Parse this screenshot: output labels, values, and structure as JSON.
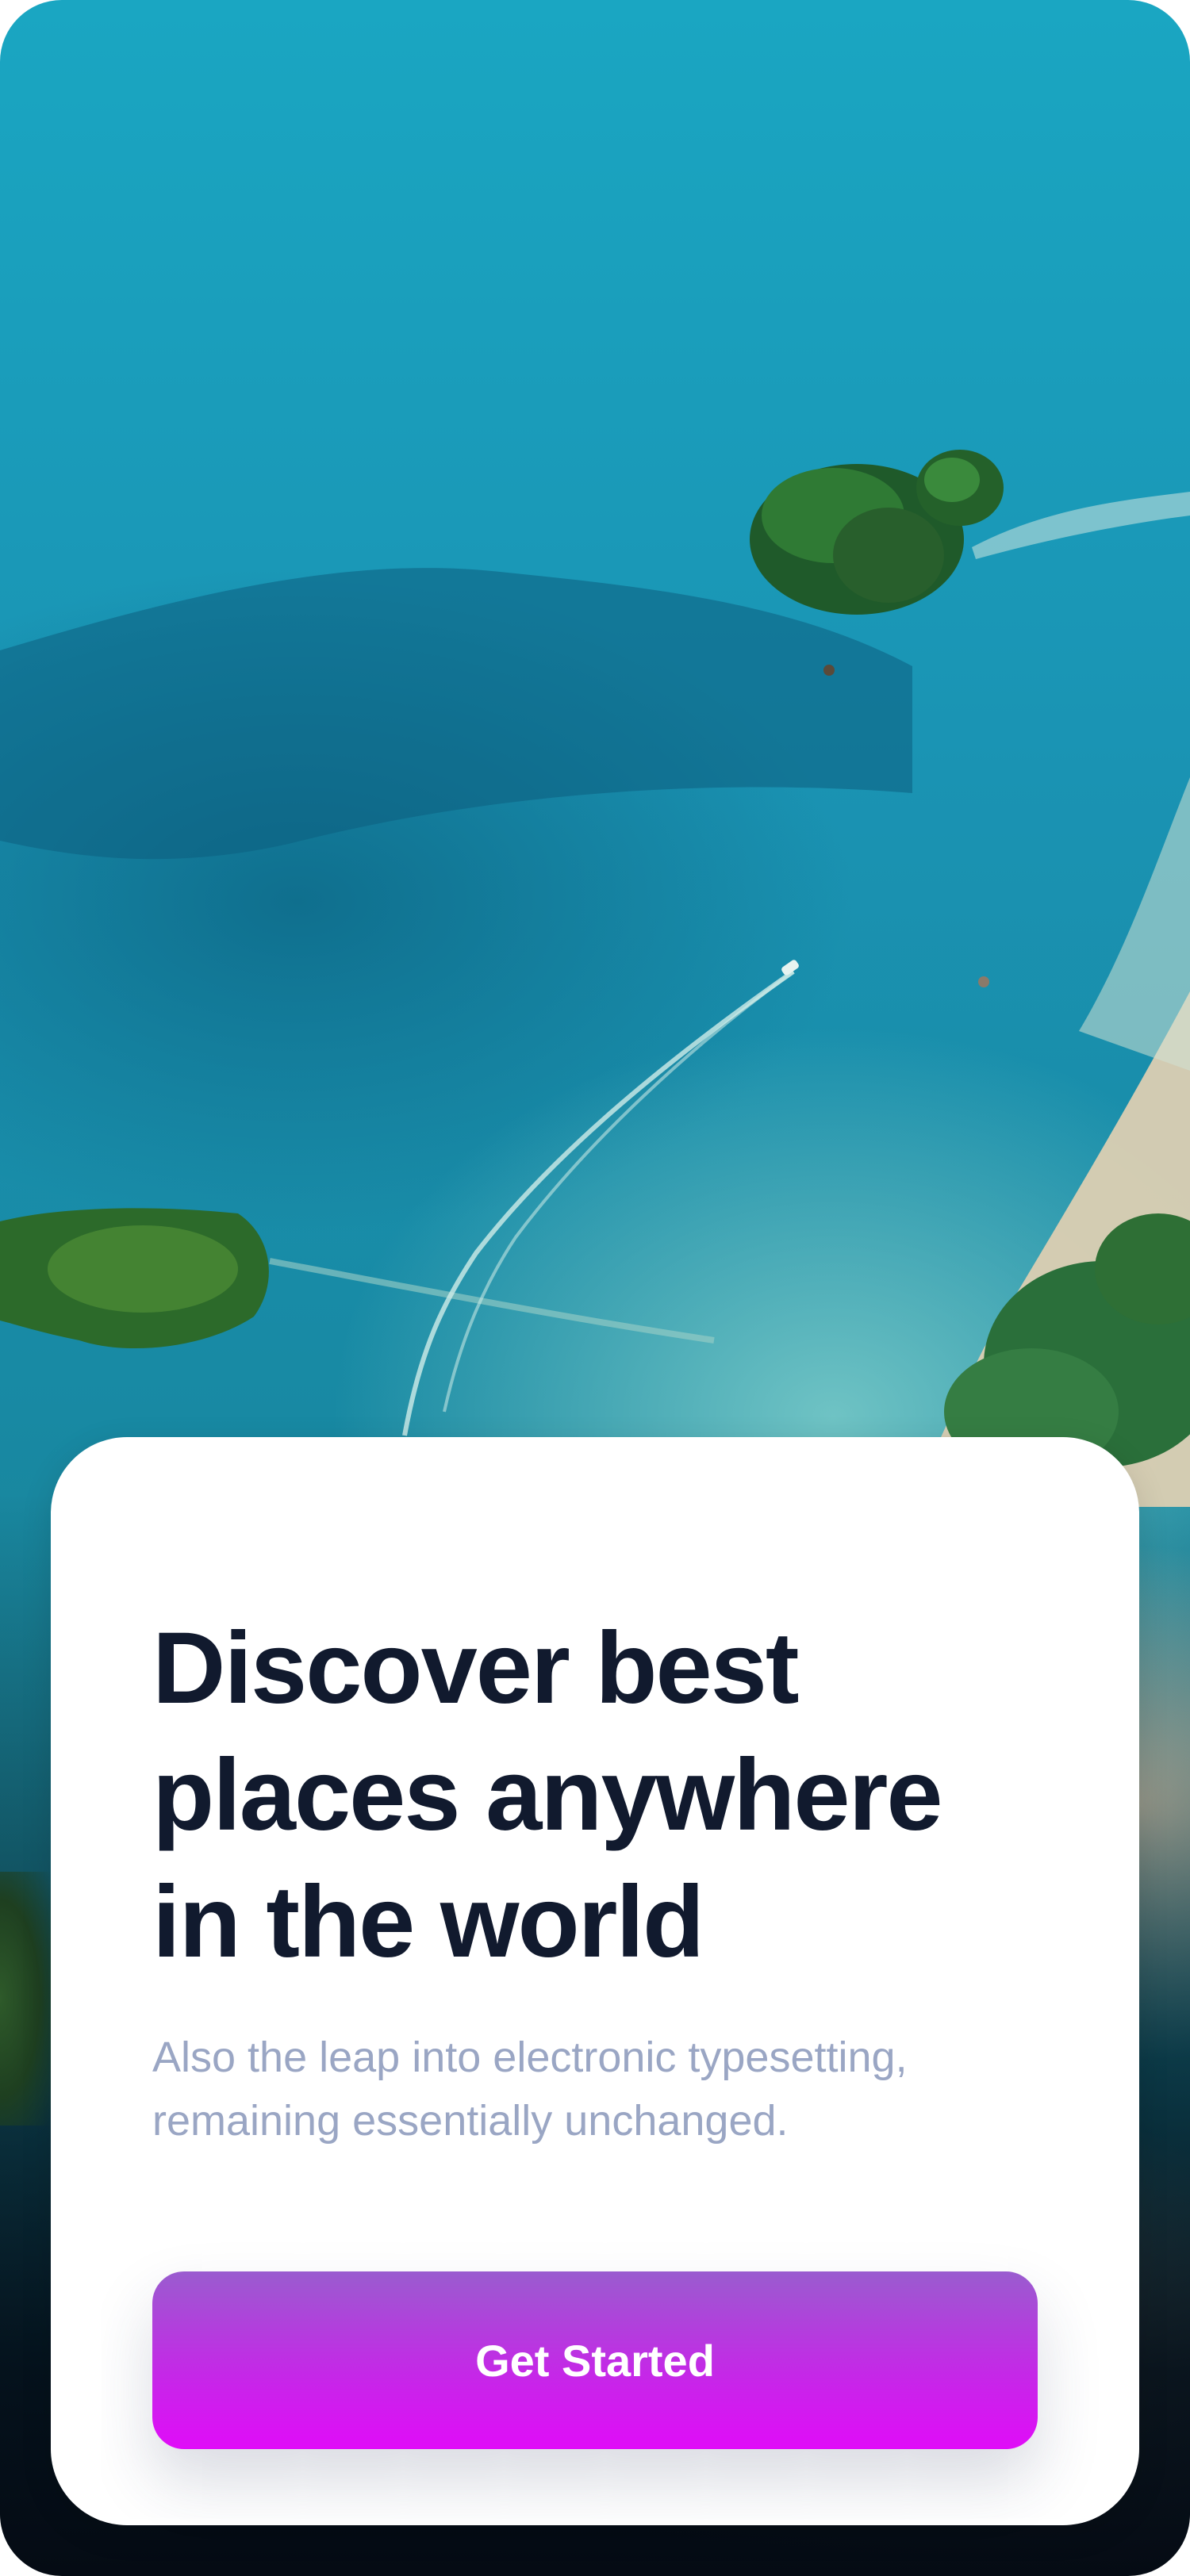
{
  "onboarding": {
    "title_lines": [
      "Discover best",
      "places anywhere",
      "in the world"
    ],
    "subtitle_lines": [
      "Also the leap into electronic typesetting,",
      "remaining essentially unchanged."
    ],
    "cta_label": "Get Started"
  },
  "colors": {
    "title": "#111a2e",
    "subtitle": "#9aa6c4",
    "cta_gradient_top": "#9a5ccf",
    "cta_gradient_bottom": "#e00cf8",
    "sheet_background": "#ffffff"
  },
  "hero_image": {
    "subject": "aerial view of turquoise sea with green islands, a motor boat wake and a sandy shoreline"
  }
}
